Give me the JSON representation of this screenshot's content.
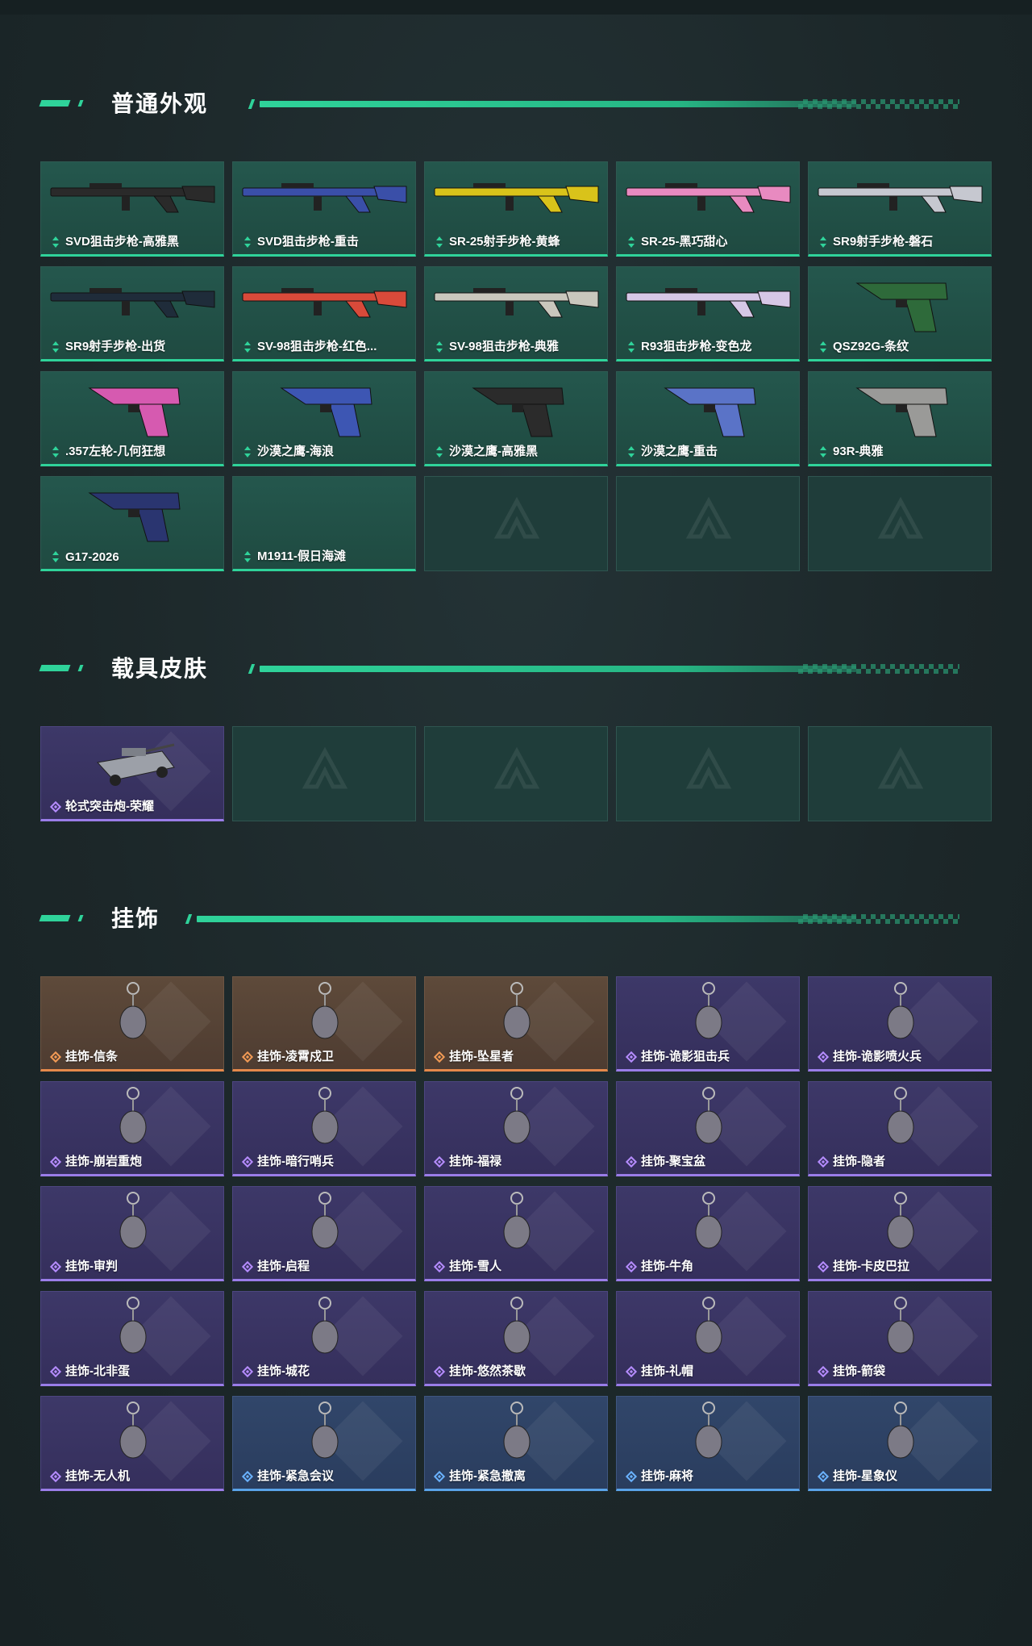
{
  "sections": {
    "weapons": {
      "title": "普通外观"
    },
    "vehicles": {
      "title": "载具皮肤"
    },
    "charms": {
      "title": "挂饰"
    }
  },
  "weapons": [
    "SVD狙击步枪-高雅黑",
    "SVD狙击步枪-重击",
    "SR-25射手步枪-黄蜂",
    "SR-25-黑巧甜心",
    "SR9射手步枪-磐石",
    "SR9射手步枪-出货",
    "SV-98狙击步枪-红色...",
    "SV-98狙击步枪-典雅",
    "R93狙击步枪-变色龙",
    "QSZ92G-条纹",
    ".357左轮-几何狂想",
    "沙漠之鹰-海浪",
    "沙漠之鹰-高雅黑",
    "沙漠之鹰-重击",
    "93R-典雅",
    "G17-2026",
    "M1911-假日海滩"
  ],
  "vehicles": [
    "轮式突击炮-荣耀"
  ],
  "charms": [
    "挂饰-信条",
    "挂饰-凌霄戍卫",
    "挂饰-坠星者",
    "挂饰-诡影狙击兵",
    "挂饰-诡影喷火兵",
    "挂饰-崩岩重炮",
    "挂饰-暗行哨兵",
    "挂饰-福禄",
    "挂饰-聚宝盆",
    "挂饰-隐者",
    "挂饰-审判",
    "挂饰-启程",
    "挂饰-雪人",
    "挂饰-牛角",
    "挂饰-卡皮巴拉",
    "挂饰-北非蛋",
    "挂饰-城花",
    "挂饰-悠然茶歇",
    "挂饰-礼帽",
    "挂饰-箭袋",
    "挂饰-无人机",
    "挂饰-紧急会议",
    "挂饰-紧急撤离",
    "挂饰-麻将",
    "挂饰-星象仪"
  ],
  "colors": {
    "accent": "#2fd39a",
    "green_card": "#24574d",
    "purple_card": "#3d3868",
    "orange_card": "#5e4a3a",
    "blue_card": "#31466a"
  }
}
